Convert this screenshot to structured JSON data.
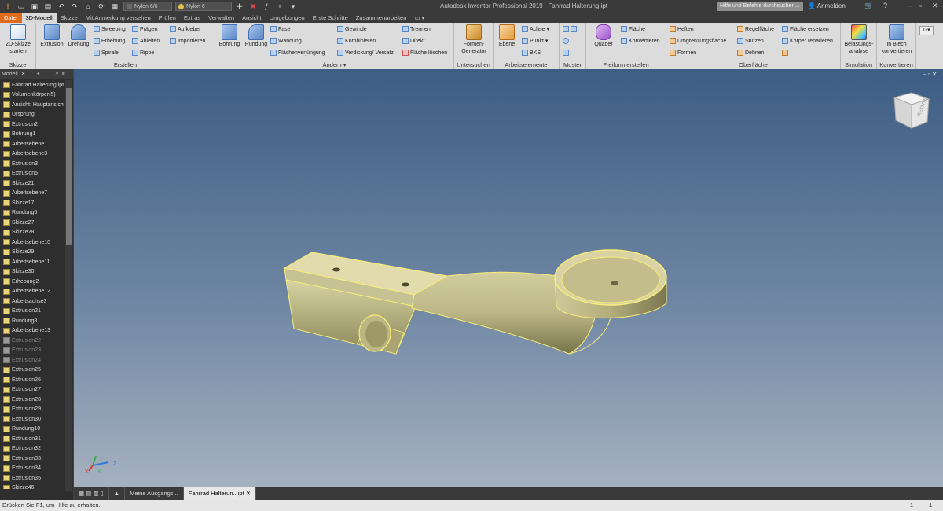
{
  "app": {
    "title": "Autodesk Inventor Professional 2019",
    "document": "Fahrrad Halterung.ipt",
    "material": "Nylon 6/6",
    "appearance": "Nylon 6",
    "search_placeholder": "Hilfe und Befehle durchsuchen...",
    "signin": "Anmelden"
  },
  "tabs": [
    "Datei",
    "3D-Modell",
    "Skizze",
    "Mit Anmerkung versehen",
    "Prüfen",
    "Extras",
    "Verwalten",
    "Ansicht",
    "Umgebungen",
    "Erste Schritte",
    "Zusammenarbeiten"
  ],
  "ribbon": {
    "skizze": {
      "label": "Skizze",
      "start": "2D-Skizze starten"
    },
    "erstellen": {
      "label": "Erstellen",
      "big": [
        "Extrusion",
        "Drehung"
      ],
      "small": [
        "Sweeping",
        "Erhebung",
        "Spirale",
        "Prägen",
        "Ableiten",
        "Rippe",
        "Aufkleber",
        "Importieren"
      ]
    },
    "aendern": {
      "label": "Ändern",
      "big": [
        "Bohrung",
        "Rundung"
      ],
      "small": [
        "Fase",
        "Wandung",
        "Flächenverjüngung",
        "Gewinde",
        "Kombinieren",
        "Verdickung/ Versatz",
        "Trennen",
        "Direkt",
        "Fläche löschen"
      ]
    },
    "untersuchen": {
      "label": "Untersuchen",
      "big": "Formen-Generator"
    },
    "arbeitselemente": {
      "label": "Arbeitselemente",
      "big": "Ebene",
      "small": [
        "Achse",
        "Punkt",
        "BKS"
      ]
    },
    "muster": {
      "label": "Muster"
    },
    "freiform": {
      "label": "Freiform erstellen",
      "big": "Quader",
      "small": [
        "Fläche",
        "Konvertieren"
      ]
    },
    "oberflaeche": {
      "label": "Oberfläche",
      "small": [
        "Heften",
        "Umgrenzungsfläche",
        "Formen",
        "Regelfläche",
        "Stutzen",
        "Dehnen",
        "Fläche ersetzen",
        "Körper reparieren"
      ]
    },
    "simulation": {
      "label": "Simulation",
      "big": "Belastungs-analyse"
    },
    "konvertieren": {
      "label": "Konvertieren",
      "big": "In Blech konvertieren"
    }
  },
  "sidebar": {
    "tab": "Modell",
    "nodes": [
      {
        "label": "Fahrrad Halterung.ipt",
        "state": "normal"
      },
      {
        "label": "Volumenkörper(5)",
        "state": "normal"
      },
      {
        "label": "Ansicht: Hauptansicht",
        "state": "normal"
      },
      {
        "label": "Ursprung",
        "state": "normal"
      },
      {
        "label": "Extrusion2",
        "state": "normal"
      },
      {
        "label": "Bohrung1",
        "state": "normal"
      },
      {
        "label": "Arbeitsebene1",
        "state": "normal"
      },
      {
        "label": "Arbeitsebene3",
        "state": "normal"
      },
      {
        "label": "Extrusion3",
        "state": "normal"
      },
      {
        "label": "Extrusion5",
        "state": "normal"
      },
      {
        "label": "Skizze21",
        "state": "normal"
      },
      {
        "label": "Arbeitsebene7",
        "state": "normal"
      },
      {
        "label": "Skizze17",
        "state": "normal"
      },
      {
        "label": "Rundung6",
        "state": "normal"
      },
      {
        "label": "Skizze27",
        "state": "normal"
      },
      {
        "label": "Skizze28",
        "state": "normal"
      },
      {
        "label": "Arbeitsebene10",
        "state": "normal"
      },
      {
        "label": "Skizze29",
        "state": "normal"
      },
      {
        "label": "Arbeitsebene11",
        "state": "normal"
      },
      {
        "label": "Skizze30",
        "state": "normal"
      },
      {
        "label": "Erhebung2",
        "state": "normal"
      },
      {
        "label": "Arbeitsebene12",
        "state": "normal"
      },
      {
        "label": "Arbeitsachse3",
        "state": "normal"
      },
      {
        "label": "Extrusion21",
        "state": "normal"
      },
      {
        "label": "Rundung8",
        "state": "normal"
      },
      {
        "label": "Arbeitsebene13",
        "state": "normal"
      },
      {
        "label": "Extrusion22",
        "state": "grey"
      },
      {
        "label": "Extrusion23",
        "state": "grey"
      },
      {
        "label": "Extrusion24",
        "state": "grey"
      },
      {
        "label": "Extrusion25",
        "state": "normal"
      },
      {
        "label": "Extrusion26",
        "state": "normal"
      },
      {
        "label": "Extrusion27",
        "state": "normal"
      },
      {
        "label": "Extrusion28",
        "state": "normal"
      },
      {
        "label": "Extrusion29",
        "state": "normal"
      },
      {
        "label": "Extrusion30",
        "state": "normal"
      },
      {
        "label": "Rundung10",
        "state": "normal"
      },
      {
        "label": "Extrusion31",
        "state": "normal"
      },
      {
        "label": "Extrusion32",
        "state": "normal"
      },
      {
        "label": "Extrusion33",
        "state": "normal"
      },
      {
        "label": "Extrusion34",
        "state": "normal"
      },
      {
        "label": "Extrusion35",
        "state": "normal"
      },
      {
        "label": "Skizze46",
        "state": "normal"
      }
    ]
  },
  "viewcube": {
    "label": "RECHTS"
  },
  "triad": {
    "x": "X",
    "y": "Y",
    "z": "Z"
  },
  "doc_tabs": [
    "Meine Ausgangs...",
    "Fahrrad Halterun...ipt"
  ],
  "status": {
    "text": "Drücken Sie F1, um Hilfe zu erhalten.",
    "n1": "1",
    "n2": "1"
  }
}
